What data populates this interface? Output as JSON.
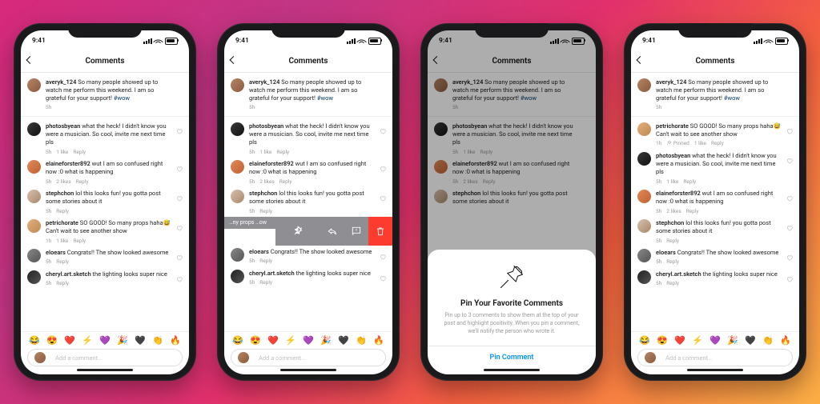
{
  "status": {
    "time": "9:41"
  },
  "header": {
    "title": "Comments"
  },
  "caption": {
    "user": "averyk_124",
    "text": "So many people showed up to watch me perform this weekend. I am so grateful for your support! ",
    "hashtag": "#wow",
    "time": "5h"
  },
  "comments": [
    {
      "user": "photosbyean",
      "text": "what the heck! I didn't know you were a musician. So cool, invite me next time pls",
      "time": "5h",
      "likes": "1 like"
    },
    {
      "user": "elaineforster892",
      "text": "wut I am so confused right now :0 what is happening",
      "time": "5h",
      "likes": "2 likes"
    },
    {
      "user": "stephchon",
      "text": "lol this looks fun! you gotta post some stories about it",
      "time": "5h",
      "likes": ""
    },
    {
      "user": "petrichorate",
      "text": "SO GOOD! So many props haha😅 Can't wait to see another show",
      "time": "1h",
      "likes": "1 like"
    },
    {
      "user": "eloears",
      "text": "Congrats!! The show looked awesome",
      "time": "5h",
      "likes": ""
    },
    {
      "user": "cheryl.art.sketch",
      "text": "the lighting looks super nice",
      "time": "5h",
      "likes": ""
    }
  ],
  "swipe": {
    "remnant_text": "…ny props …ow"
  },
  "reply_label": "Reply",
  "pinned_label": "Pinned",
  "emoji_row": [
    "😂",
    "😍",
    "❤️",
    "⚡",
    "💜",
    "🎉",
    "🖤",
    "👏",
    "🔥"
  ],
  "input_placeholder": "Add a comment...",
  "sheet": {
    "title": "Pin Your Favorite Comments",
    "body": "Pin up to 3 comments to show them at the top of your post and highlight positivity. When you pin a comment, we'll notify the person who wrote it.",
    "primary": "Pin Comment"
  }
}
